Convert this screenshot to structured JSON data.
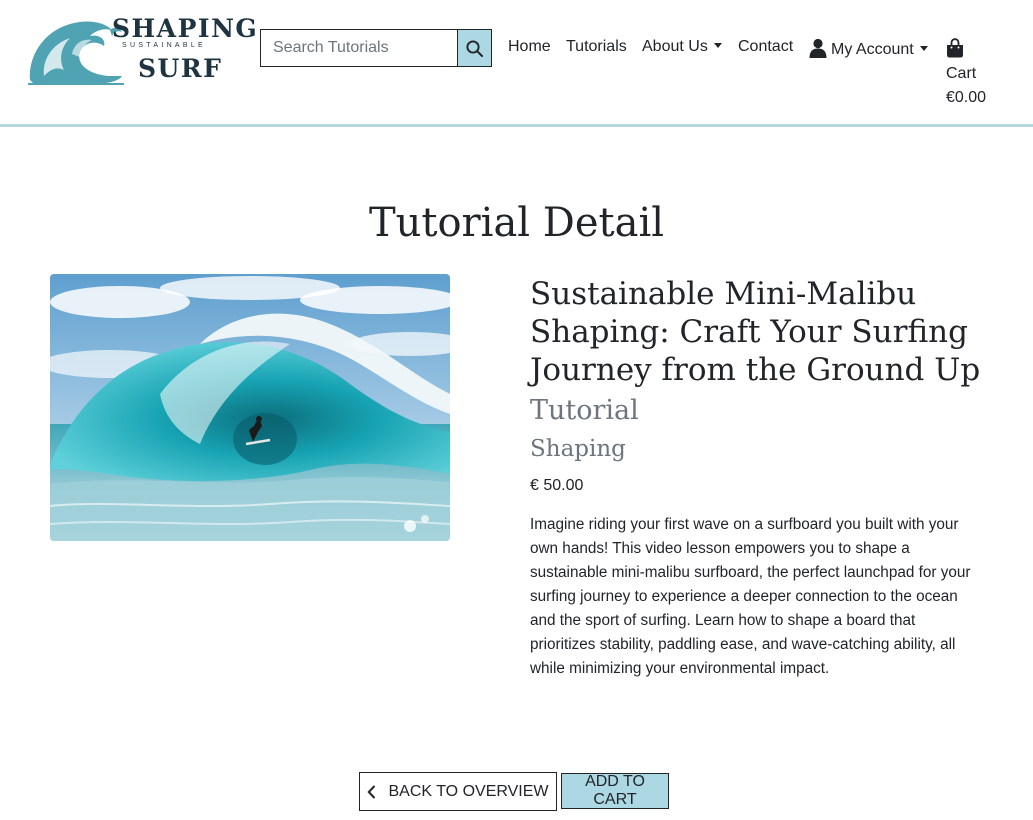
{
  "brand": {
    "line1": "SHAPING",
    "line2": "SUSTAINABLE",
    "line3": "SURF",
    "logo_icon": "wave-logo"
  },
  "search": {
    "placeholder": "Search Tutorials",
    "value": "",
    "icon": "search-icon"
  },
  "nav": {
    "home": "Home",
    "tutorials": "Tutorials",
    "about": "About Us",
    "contact": "Contact",
    "account": "My Account",
    "cart_label": "Cart",
    "cart_total": "€0.00"
  },
  "page": {
    "title": "Tutorial Detail"
  },
  "tutorial": {
    "name": "Sustainable Mini-Malibu Shaping: Craft Your Surfing Journey from the Ground Up",
    "category": "Tutorial",
    "subcategory": "Shaping",
    "price": "€ 50.00",
    "description": "Imagine riding your first wave on a surfboard you built with your own hands! This video lesson empowers you to shape a sustainable mini-malibu surfboard, the perfect launchpad for your surfing journey to experience a deeper connection to the ocean and the sport of surfing. Learn how to shape a board that prioritizes stability, paddling ease, and wave-catching ability, all while minimizing your environmental impact."
  },
  "actions": {
    "back": "Back to Overview",
    "add_to_cart": "Add to Cart"
  },
  "colors": {
    "accent": "#acd8e3",
    "navbar_border": "#b3d7db",
    "brand_dark": "#1e3440",
    "logo_teal": "#4fa3b2"
  }
}
